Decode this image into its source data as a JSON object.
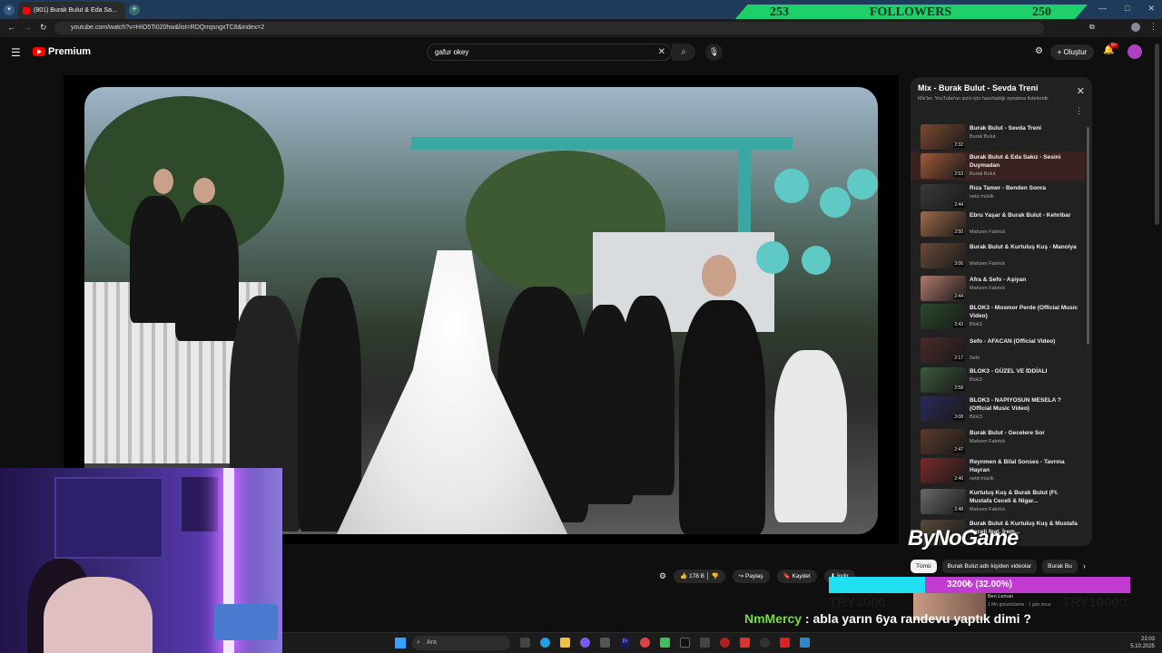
{
  "browser": {
    "tab_title": "(801) Burak Bulut & Eda Sa...",
    "url": "youtube.com/watch?v=HIO5Ti020hw&list=RDQrrqsngxTC8&index=2"
  },
  "stream_overlay": {
    "followers_left": "253",
    "followers_label": "FOLLOWERS",
    "followers_right": "250",
    "brand": "ByNoGame",
    "donation_label": "3200₺ (32.00%)",
    "donation_fraction": 0.32,
    "donation_start": "TRY3000",
    "donation_goal": "TRY10000",
    "chat_user": "NmMercy",
    "chat_message": " : abla yarın 6ya randevu yaptık dimi ?"
  },
  "youtube": {
    "logo_text": "Premium",
    "search_value": "gafur okey",
    "create_label": "Oluştur",
    "notif_count": "9+"
  },
  "playlist": {
    "title": "Mix - Burak Bulut - Sevda Treni",
    "subtitle": "Mix'ler, YouTube'un sizin için hazırladığı oynatma listeleridir",
    "items": [
      {
        "title": "Burak Bulut - Sevda Treni",
        "channel": "Burak Bulut",
        "duration": "2:32",
        "active": false
      },
      {
        "title": "Burak Bulut & Eda Sakız - Sesini Duymadan",
        "channel": "Burak Bulut",
        "duration": "2:53",
        "active": true
      },
      {
        "title": "Rıza Tamer - Benden Sonra",
        "channel": "netd müzik",
        "duration": "2:44",
        "active": false
      },
      {
        "title": "Ebru Yaşar & Burak Bulut - Kehribar",
        "channel": "Mahzen Fabrick",
        "duration": "2:50",
        "active": false
      },
      {
        "title": "Burak Bulut & Kurtuluş Kuş - Manolya",
        "channel": "Mahzen Fabrick",
        "duration": "3:06",
        "active": false
      },
      {
        "title": "Afra & Sefo - Aşiyan",
        "channel": "Mahzen Fabrick",
        "duration": "2:44",
        "active": false
      },
      {
        "title": "BLOK3 - Mosmor Perde (Official Music Video)",
        "channel": "Blok3",
        "duration": "2:43",
        "active": false
      },
      {
        "title": "Sefo - AFACAN (Official Video)",
        "channel": "Sefo",
        "duration": "2:17",
        "active": false
      },
      {
        "title": "BLOK3 - GÜZEL VE İDDİALI",
        "channel": "Blok3",
        "duration": "2:58",
        "active": false
      },
      {
        "title": "BLOK3 - NAPIYOSUN MESELA ? (Official Music Video)",
        "channel": "Blok3",
        "duration": "3:08",
        "active": false
      },
      {
        "title": "Burak Bulut - Gecelere Sor",
        "channel": "Mahzen Fabrick",
        "duration": "2:47",
        "active": false
      },
      {
        "title": "Reynmen & Bilal Sonses - Tavrına Hayran",
        "channel": "netd müzik",
        "duration": "2:46",
        "active": false
      },
      {
        "title": "Kurtuluş Kuş & Burak Bulut (Ft. Mustafa Ceceli & Nigar...",
        "channel": "Mahzen Fabrick",
        "duration": "2:48",
        "active": false
      },
      {
        "title": "Burak Bulut & Kurtuluş Kuş & Mustafa Ceceli feat. İrem...",
        "channel": "",
        "duration": "",
        "active": false
      }
    ]
  },
  "chips": [
    "Tümü",
    "Burak Bulut adlı kişiden videolar",
    "Burak Bu"
  ],
  "actions": {
    "like_count": "178 B",
    "share": "Paylaş",
    "save": "Kaydet",
    "download": "İndir"
  },
  "mini_card": {
    "channel": "Ben Leman",
    "meta": "1 Mn görüntüleme · 1 gün önce"
  },
  "taskbar": {
    "search_placeholder": "Ara",
    "time": "23:03",
    "date": "5.10.2025"
  }
}
